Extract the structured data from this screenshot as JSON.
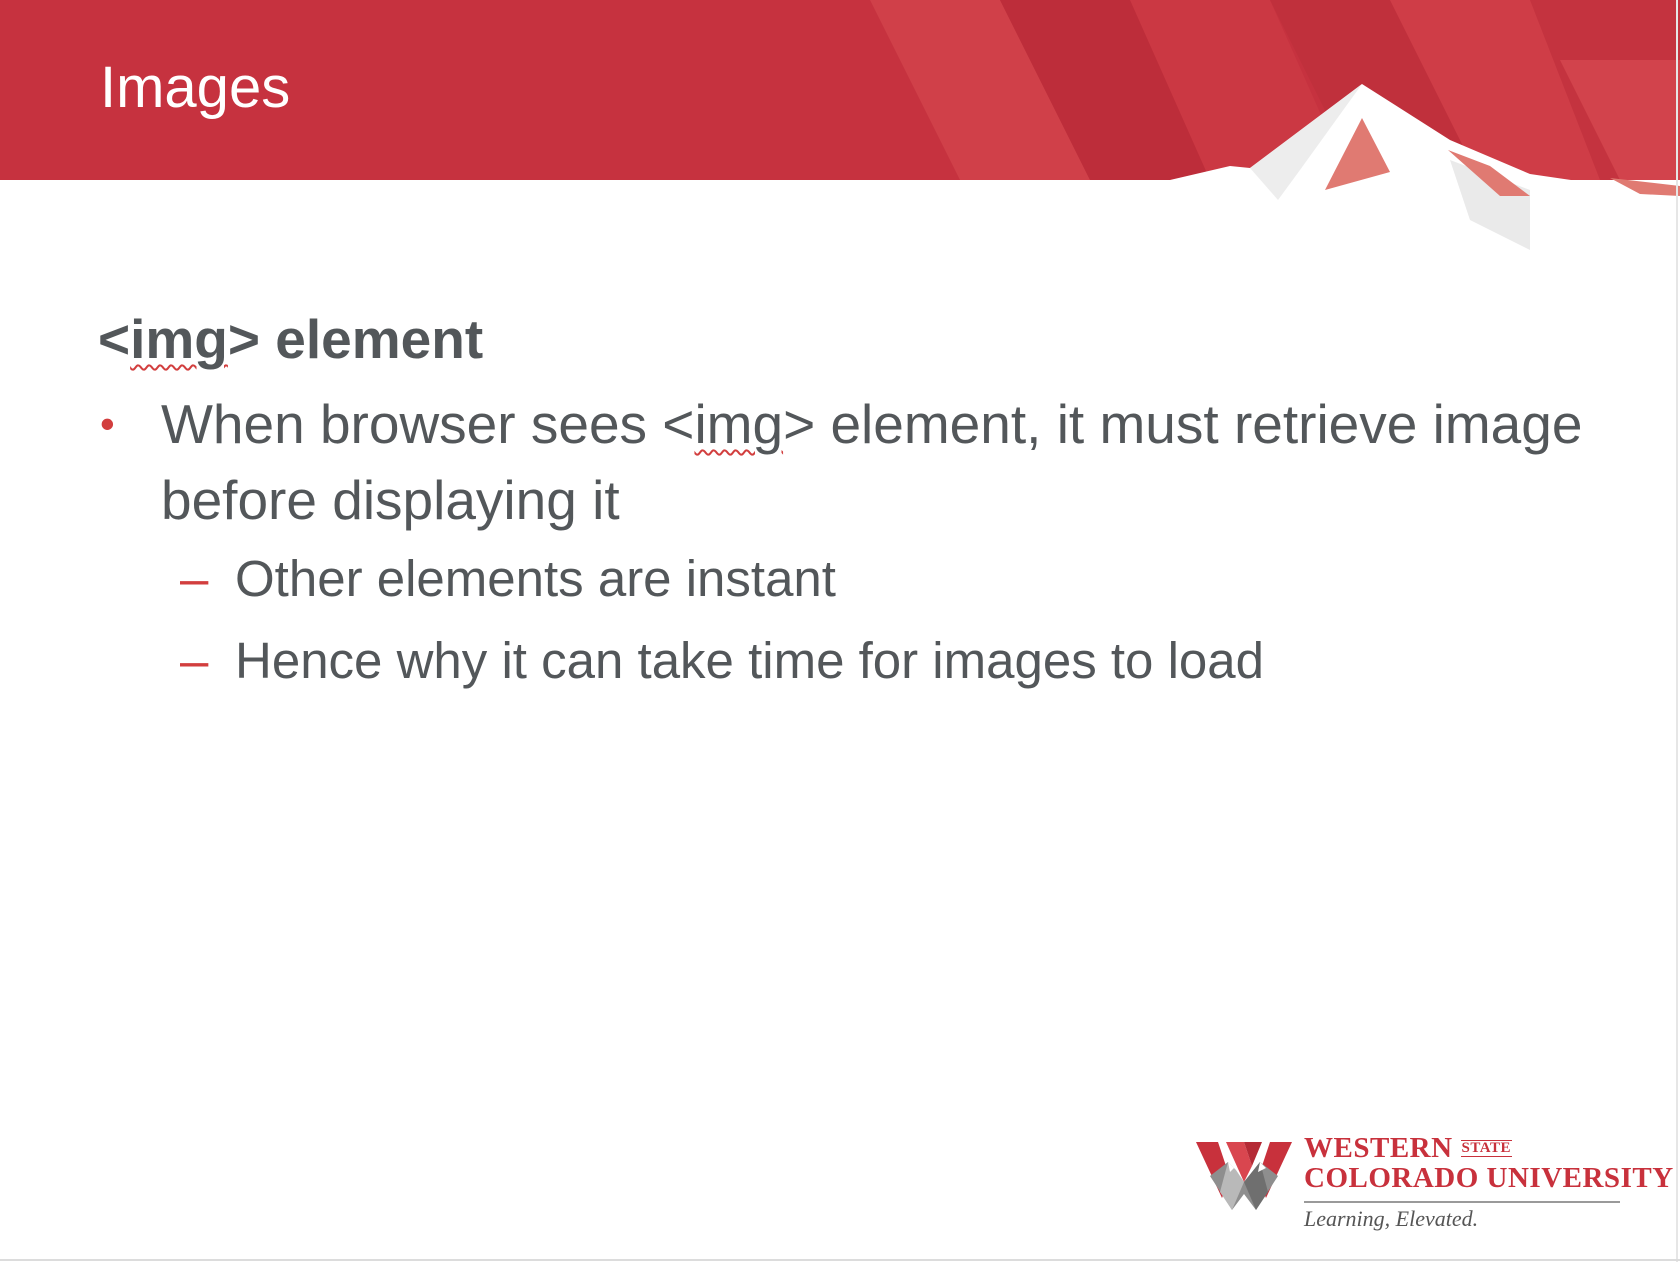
{
  "slide": {
    "title": "Images",
    "heading_parts": [
      "<",
      "img",
      "> element"
    ],
    "bullets": [
      {
        "marker": "•",
        "text_parts": [
          "When browser sees <",
          "img",
          "> element, it must retrieve image before displaying it"
        ],
        "sub_items": [
          {
            "marker": "–",
            "text": "Other elements are instant"
          },
          {
            "marker": "–",
            "text": "Hence why it can take time for images to load"
          }
        ]
      }
    ]
  },
  "logo": {
    "line1": "WESTERN",
    "state": "STATE",
    "line2": "COLORADO UNIVERSITY",
    "tagline": "Learning, Elevated."
  },
  "colors": {
    "banner_red": "#c8313c",
    "text_gray": "#53575a",
    "accent_red": "#d23e3e",
    "background": "#ffffff"
  }
}
